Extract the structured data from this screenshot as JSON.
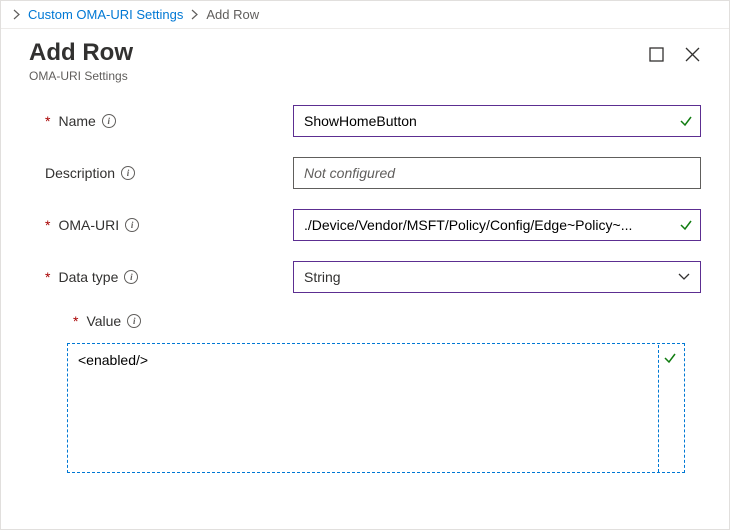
{
  "breadcrumb": {
    "parent": "Custom OMA-URI Settings",
    "current": "Add Row"
  },
  "header": {
    "title": "Add Row",
    "subtitle": "OMA-URI Settings"
  },
  "form": {
    "name": {
      "label": "Name",
      "value": "ShowHomeButton"
    },
    "description": {
      "label": "Description",
      "placeholder": "Not configured",
      "value": ""
    },
    "omaUri": {
      "label": "OMA-URI",
      "value": "./Device/Vendor/MSFT/Policy/Config/Edge~Policy~..."
    },
    "dataType": {
      "label": "Data type",
      "value": "String"
    },
    "value": {
      "label": "Value",
      "value": "<enabled/>"
    }
  }
}
